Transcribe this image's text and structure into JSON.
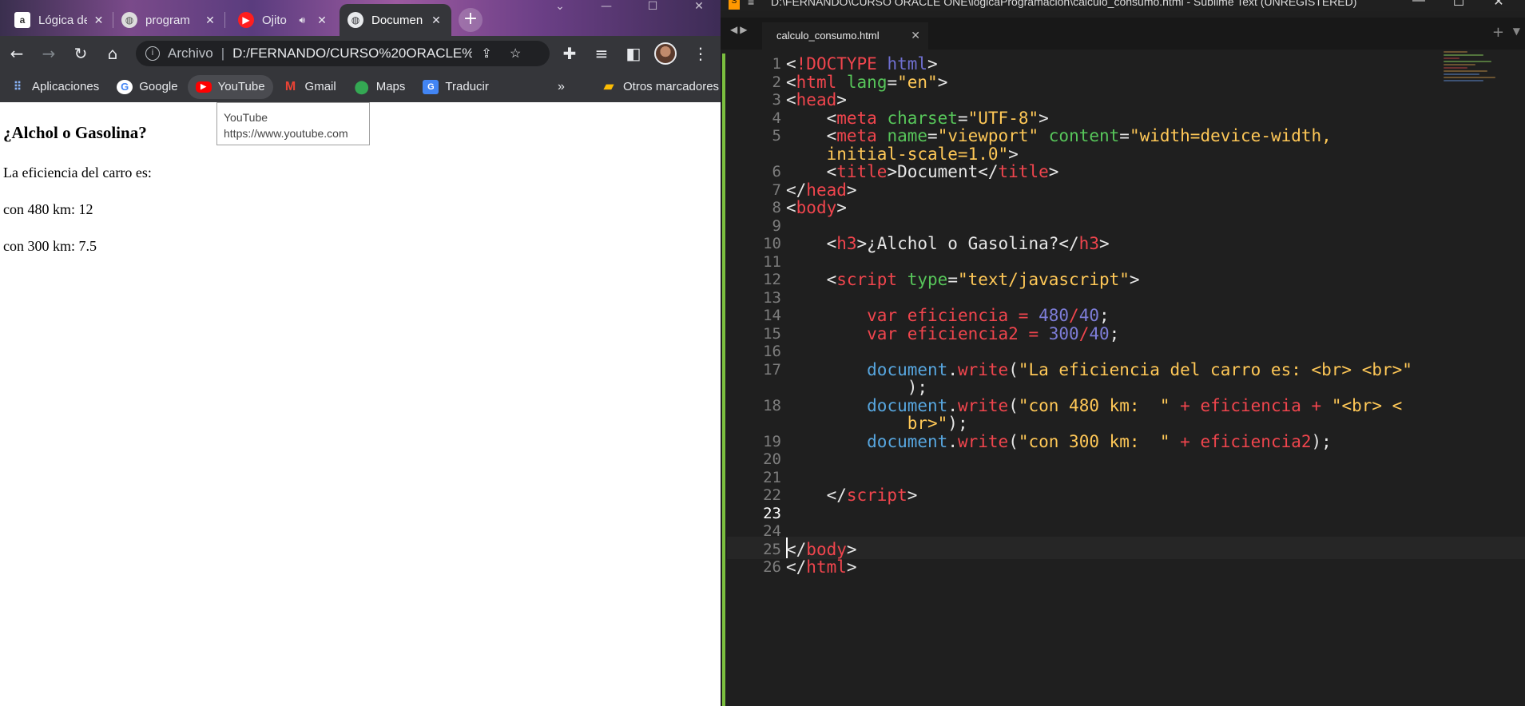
{
  "browser": {
    "tabs": [
      {
        "title": "Lógica de",
        "icon": "alura-icon"
      },
      {
        "title": "program",
        "icon": "globe-icon"
      },
      {
        "title": "Ojito",
        "icon": "youtube-music-icon"
      },
      {
        "title": "Documen",
        "icon": "globe-icon",
        "active": true
      }
    ],
    "toolbar": {
      "address_prefix": "Archivo",
      "url": "D:/FERNANDO/CURSO%20ORACLE%2..."
    },
    "bookmarks": [
      {
        "label": "Aplicaciones",
        "icon": "apps-grid-icon"
      },
      {
        "label": "Google",
        "icon": "google-icon"
      },
      {
        "label": "YouTube",
        "icon": "youtube-icon"
      },
      {
        "label": "Gmail",
        "icon": "gmail-icon"
      },
      {
        "label": "Maps",
        "icon": "maps-icon"
      },
      {
        "label": "Traducir",
        "icon": "translate-icon"
      }
    ],
    "bookmarks_more": "»",
    "other_bookmarks": "Otros marcadores",
    "tooltip": {
      "title": "YouTube",
      "url": "https://www.youtube.com"
    },
    "page": {
      "heading": "¿Alchol o Gasolina?",
      "line1": "La eficiencia del carro es:",
      "line2": "con 480 km: 12",
      "line3": "con 300 km: 7.5"
    }
  },
  "editor": {
    "title": "D:\\FERNANDO\\CURSO ORACLE ONE\\logicaProgramacion\\calculo_consumo.html - Sublime Text (UNREGISTERED)",
    "tab": "calculo_consumo.html",
    "current_line": 23,
    "colors": {
      "tag": "#f0454d",
      "attr": "#57c65a",
      "string": "#ffc857",
      "number": "#7d7dd8",
      "accent": "#7bbf3f"
    }
  }
}
